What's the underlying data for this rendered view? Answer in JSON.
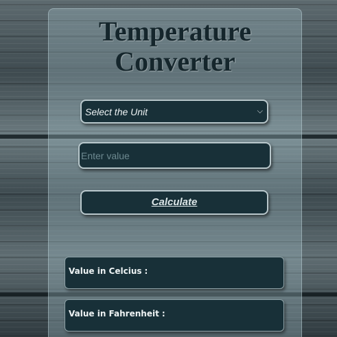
{
  "page": {
    "title_line1": "Temperature",
    "title_line2": "Converter"
  },
  "form": {
    "unit_select_value": "Select the Unit",
    "value_placeholder": "Enter value",
    "calculate_label": "Calculate"
  },
  "results": {
    "celsius_label": "Value in Celcius",
    "fahrenheit_label": "Value in Fahrenheit",
    "separator": ":"
  },
  "icons": {
    "select_chevron": "chevron-down-icon"
  },
  "colors": {
    "field_bg": "#183038",
    "field_border": "#b9c8cc",
    "title": "#15262c",
    "text": "#eef3f4"
  }
}
